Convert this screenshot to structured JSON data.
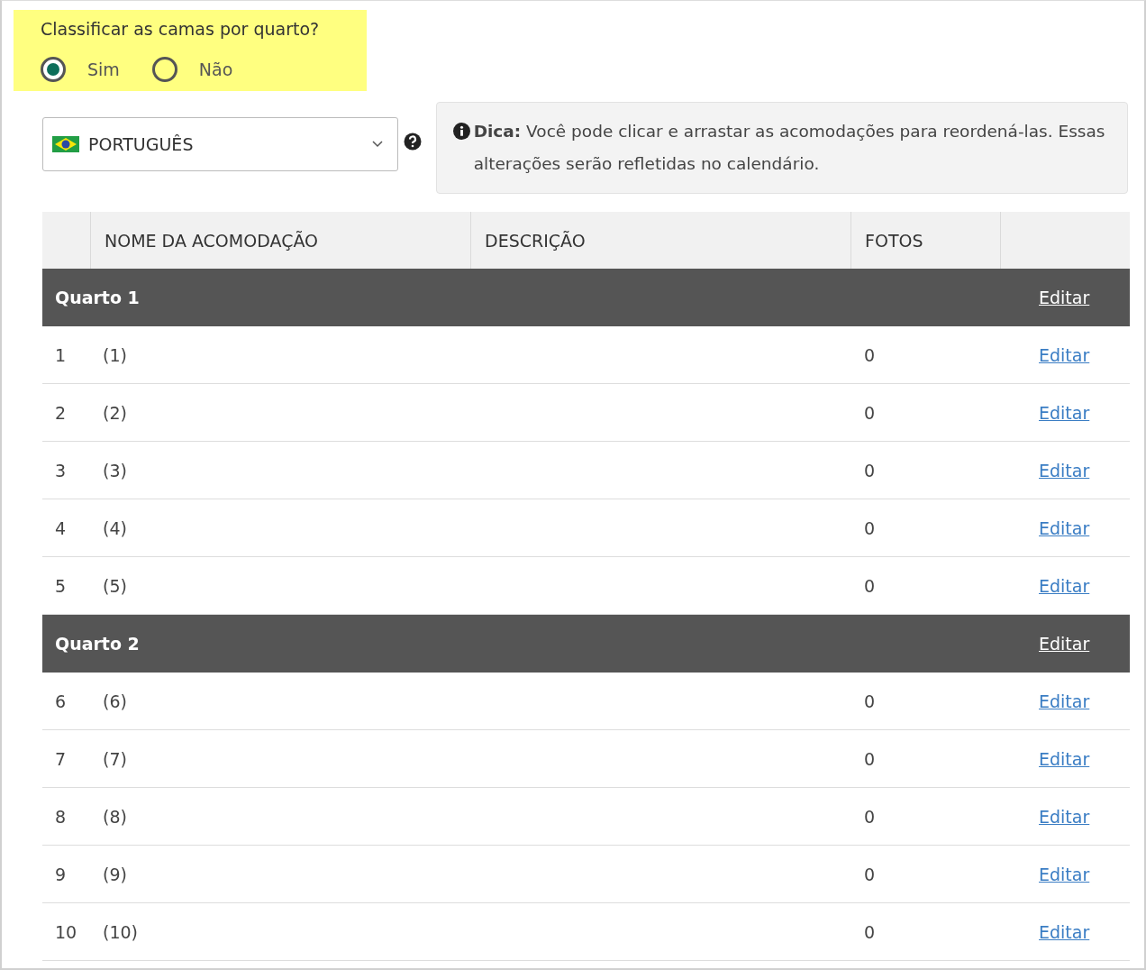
{
  "question": {
    "label": "Classificar as camas por quarto?",
    "options": [
      {
        "label": "Sim",
        "selected": true
      },
      {
        "label": "Não",
        "selected": false
      }
    ]
  },
  "language_select": {
    "value": "PORTUGUÊS"
  },
  "tip": {
    "text": "**Dica:** Você pode clicar e arrastar as acomodações para reordená-las. Essas alterações serão refletidas no calendário."
  },
  "table": {
    "columns": [
      "NOME DA ACOMODAÇÃO",
      "DESCRIÇÃO",
      "FOTOS"
    ],
    "groups": [
      {
        "name": "Quarto 1",
        "action": "Editar",
        "rows": [
          {
            "number": "1",
            "name": "(1)",
            "photos": "0",
            "action": "Editar"
          },
          {
            "number": "2",
            "name": "(2)",
            "photos": "0",
            "action": "Editar"
          },
          {
            "number": "3",
            "name": "(3)",
            "photos": "0",
            "action": "Editar"
          },
          {
            "number": "4",
            "name": "(4)",
            "photos": "0",
            "action": "Editar"
          },
          {
            "number": "5",
            "name": "(5)",
            "photos": "0",
            "action": "Editar"
          }
        ]
      },
      {
        "name": "Quarto 2",
        "action": "Editar",
        "rows": [
          {
            "number": "6",
            "name": "(6)",
            "photos": "0",
            "action": "Editar"
          },
          {
            "number": "7",
            "name": "(7)",
            "photos": "0",
            "action": "Editar"
          },
          {
            "number": "8",
            "name": "(8)",
            "photos": "0",
            "action": "Editar"
          },
          {
            "number": "9",
            "name": "(9)",
            "photos": "0",
            "action": "Editar"
          },
          {
            "number": "10",
            "name": "(10)",
            "photos": "0",
            "action": "Editar"
          }
        ]
      }
    ]
  }
}
